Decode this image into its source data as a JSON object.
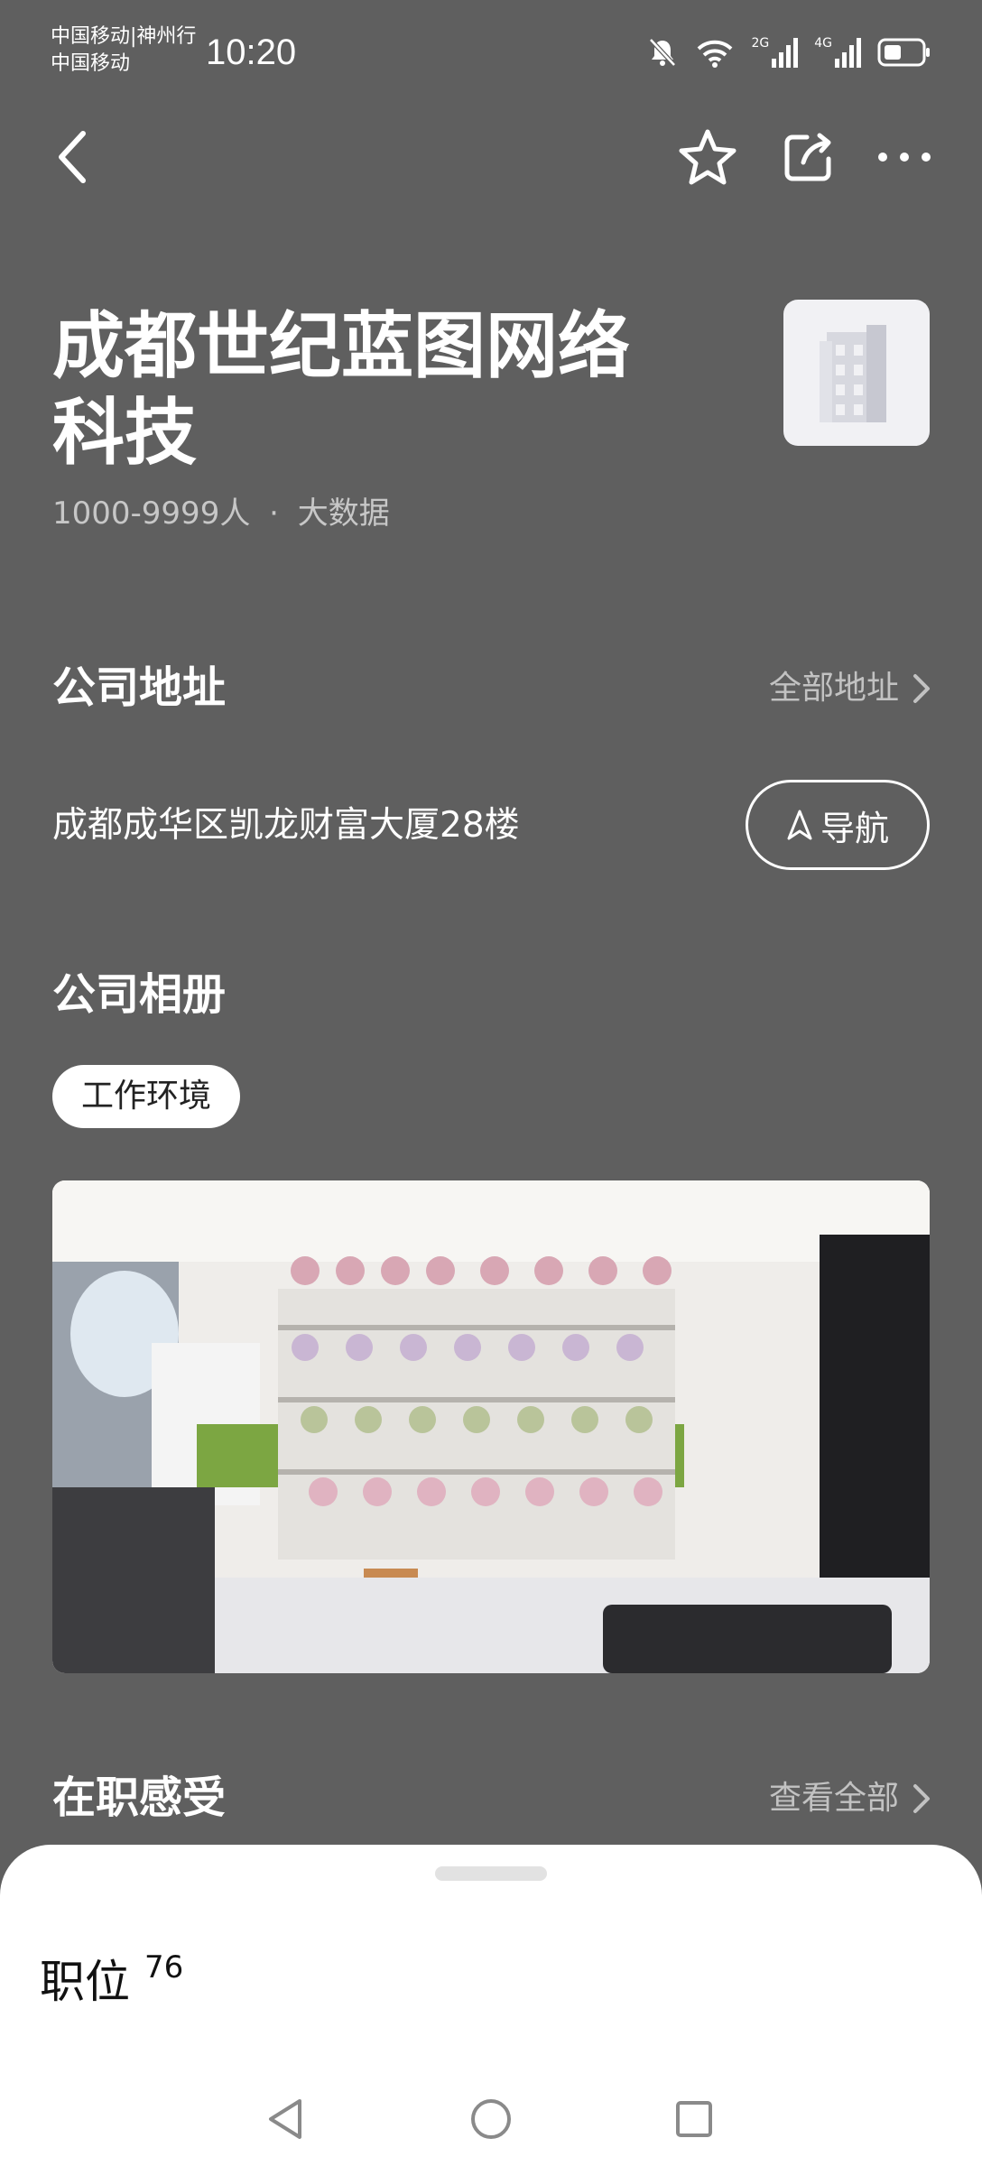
{
  "status_bar": {
    "carrier_line1": "中国移动|神州行",
    "carrier_line2": "中国移动",
    "time": "10:20",
    "signal_1": "2G",
    "signal_2": "4G",
    "icons": [
      "mute-bell-icon",
      "wifi-icon",
      "signal-icon",
      "signal-icon",
      "battery-icon"
    ]
  },
  "toolbar": {
    "icons": [
      "back-arrow-icon",
      "star-icon",
      "share-icon",
      "more-icon"
    ]
  },
  "company": {
    "name": "成都世纪蓝图网络科技",
    "size": "1000-9999人",
    "separator": "·",
    "industry": "大数据",
    "logo_icon": "building-icon"
  },
  "address_section": {
    "title": "公司地址",
    "link": "全部地址",
    "address": "成都成华区凯龙财富大厦28楼",
    "nav_button": "导航"
  },
  "album_section": {
    "title": "公司相册",
    "tabs": [
      "工作环境"
    ]
  },
  "review_section": {
    "title": "在职感受",
    "link": "查看全部"
  },
  "bottom_sheet": {
    "label": "职位",
    "count": "76"
  },
  "colors": {
    "background": "#5f5f5f",
    "sheet": "#ffffff",
    "muted_text": "#c2c2c2"
  }
}
